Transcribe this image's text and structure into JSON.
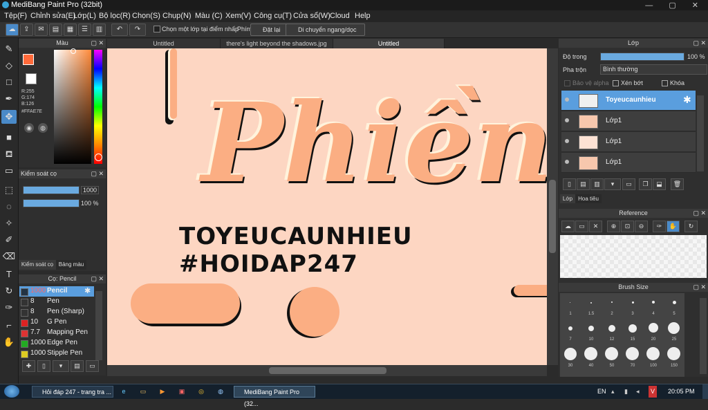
{
  "window": {
    "title": "MediBang Paint Pro (32bit)",
    "controls": "— ▢ ✕"
  },
  "menu": [
    "Tệp(F)",
    "Chỉnh sửa(E)",
    "Lớp(L)",
    "Bộ lọc(R)",
    "Chọn(S)",
    "Chụp(N)",
    "Màu (C)",
    "Xem(V)",
    "Công cụ(T)",
    "Cửa sổ(W)",
    "Cloud",
    "Help"
  ],
  "toolbar": {
    "select_one_layer": "Chọn một lớp tại điểm nhấp",
    "shortcut_label": "Phím",
    "reset": "Đặt lại",
    "move_hv": "Di chuyển ngang/dọc",
    "undo_icon": "undo-icon",
    "redo_icon": "redo-icon"
  },
  "color_panel": {
    "title": "Màu",
    "rgb": {
      "r": "R:255",
      "g": "G:174",
      "b": "B:126"
    },
    "hex": "#FFAE7E",
    "fg_color": "#FF6A3A",
    "bg_color": "#FFFFFF"
  },
  "brush_control": {
    "title": "Kiểm soát cọ",
    "size_value": "1000",
    "opacity_value": "100 %",
    "tab1": "Kiểm soát cọ",
    "tab2": "Bảng màu"
  },
  "brush_list": {
    "title": "Cọ: Pencil",
    "items": [
      {
        "size": "1000",
        "name": "Pencil",
        "color": "#223344"
      },
      {
        "size": "8",
        "name": "Pen",
        "color": "#333333"
      },
      {
        "size": "8",
        "name": "Pen (Sharp)",
        "color": "#333333"
      },
      {
        "size": "10",
        "name": "G Pen",
        "color": "#dd2222"
      },
      {
        "size": "7.7",
        "name": "Mapping Pen",
        "color": "#dd3333"
      },
      {
        "size": "1000",
        "name": "Edge Pen",
        "color": "#22aa22"
      },
      {
        "size": "1000",
        "name": "Stipple Pen",
        "color": "#ddcc22"
      }
    ]
  },
  "tabs": [
    "Untitled",
    "there's light beyond the shadows.jpg",
    "Untitled"
  ],
  "canvas": {
    "big_word": "Phiền",
    "line1": "TOYEUCAUNHIEU",
    "line2": "#HOIDAP247",
    "bg": "#fdd6c2",
    "accent": "#fbae83"
  },
  "layer_panel": {
    "title": "Lớp",
    "opacity_label": "Độ trong",
    "opacity_value": "100 %",
    "blend_label": "Pha trộn",
    "blend_value": "Bình thường",
    "protect_alpha": "Bảo vệ alpha",
    "clipping": "Xén bớt",
    "lock": "Khóa",
    "layers": [
      {
        "name": "Toyeucaunhieu"
      },
      {
        "name": "Lớp1"
      },
      {
        "name": "Lớp1"
      },
      {
        "name": "Lớp1"
      }
    ],
    "tab1": "Lớp",
    "tab2": "Hoa tiêu"
  },
  "reference_panel": {
    "title": "Reference"
  },
  "brush_size_panel": {
    "title": "Brush Size",
    "sizes": [
      "1",
      "1.5",
      "2",
      "3",
      "4",
      "5",
      "7",
      "10",
      "12",
      "15",
      "20",
      "25",
      "30",
      "40",
      "50",
      "70",
      "100",
      "150"
    ]
  },
  "taskbar": {
    "task1": "Hỏi đáp 247 - trang tra ...",
    "task2": "MediBang Paint Pro (32...",
    "lang": "EN",
    "time": "20:05 PM"
  }
}
